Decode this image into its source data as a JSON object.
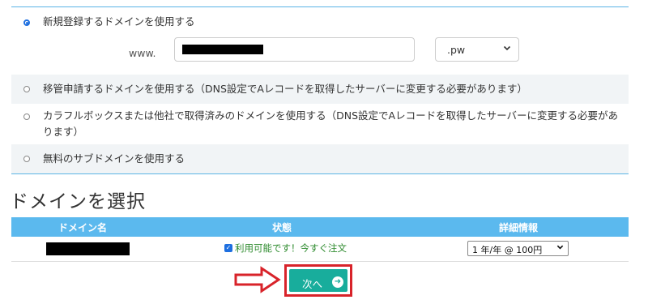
{
  "domain_options": [
    {
      "label": "新規登録するドメインを使用する",
      "selected": true
    },
    {
      "label": "移管申請するドメインを使用する（DNS設定でAレコードを取得したサーバーに変更する必要があります）",
      "selected": false
    },
    {
      "label": "カラフルボックスまたは他社で取得済みのドメインを使用する（DNS設定でAレコードを取得したサーバーに変更する必要があります）",
      "selected": false
    },
    {
      "label": "無料のサブドメインを使用する",
      "selected": false
    }
  ],
  "domain_form": {
    "prefix": "www.",
    "domain_value": "",
    "tld_selected": ".pw"
  },
  "section_title": "ドメインを選択",
  "table": {
    "headers": [
      "ドメイン名",
      "状態",
      "詳細情報"
    ],
    "rows": [
      {
        "domain": "",
        "status": "利用可能です！今すぐ注文",
        "term": "1 年/年 @ 100円"
      }
    ]
  },
  "next_button": {
    "label": "次へ"
  },
  "colors": {
    "accent_blue": "#5bb9ee",
    "button_teal": "#18ad9c",
    "highlight_red": "#d8232a",
    "status_green": "#2e8b2e"
  }
}
